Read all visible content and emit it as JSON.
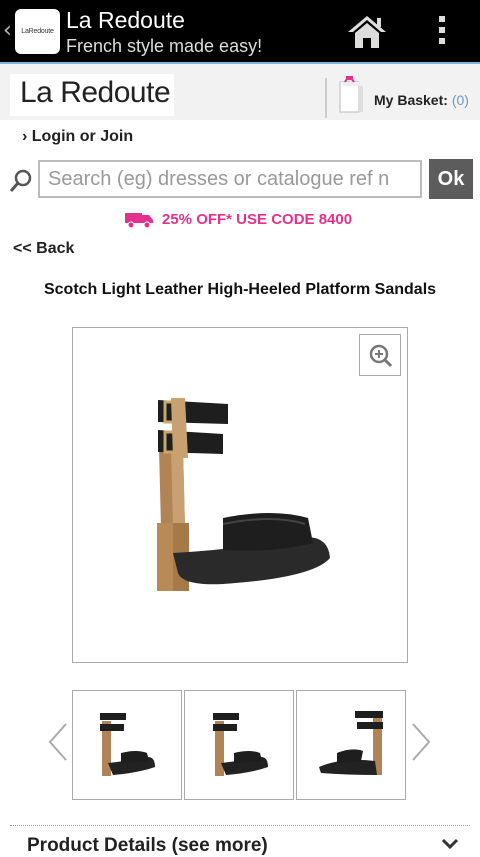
{
  "app": {
    "logo_text": "LaRedoute",
    "title": "La Redoute",
    "subtitle": "French style made easy!"
  },
  "header": {
    "brand": "La Redoute",
    "basket_label": "My Basket:",
    "basket_count": "(0)"
  },
  "account": {
    "login_label": "› Login or Join"
  },
  "search": {
    "placeholder": "Search (eg) dresses or catalogue ref n",
    "ok_label": "Ok"
  },
  "promo": {
    "text": "25% OFF* USE CODE 8400",
    "color": "#e2328d"
  },
  "nav": {
    "back_label": "<< Back"
  },
  "product": {
    "title": "Scotch Light Leather High-Heeled Platform Sandals",
    "details_label": "Product Details (see more)"
  },
  "colors": {
    "action_bar": "#000000",
    "accent_line": "#7fb5d7",
    "ok_button": "#5c5c5c"
  }
}
